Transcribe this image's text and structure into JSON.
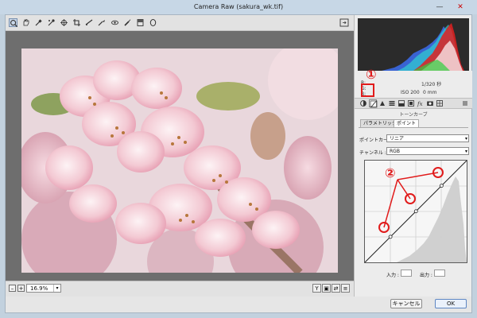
{
  "window": {
    "title": "Camera Raw (sakura_wk.tif)",
    "controls": {
      "minimize": "—",
      "close": "✕"
    }
  },
  "toolbar": {
    "tools": [
      "zoom-tool-icon",
      "hand-tool-icon",
      "white-balance-tool-icon",
      "color-sampler-tool-icon",
      "targeted-adjustment-tool-icon",
      "crop-tool-icon",
      "straighten-tool-icon",
      "spot-removal-tool-icon",
      "red-eye-removal-tool-icon",
      "adjustment-brush-icon",
      "graduated-filter-icon",
      "radial-filter-icon"
    ]
  },
  "preview": {
    "zoom_value": "16.9%",
    "zoom_minus": "–",
    "zoom_plus": "+",
    "dropdown_glyph": "▾",
    "view_buttons": [
      "Y",
      "▣",
      "⇄",
      "≡"
    ]
  },
  "camera_info": {
    "r_label": "R:",
    "g_label": "G:",
    "b_label": "B:",
    "shutter": "1/320 秒",
    "iso": "ISO 200",
    "focal_length": "0 mm"
  },
  "panel": {
    "section_title": "トーンカーブ",
    "tab_parametric": "パラメトリック",
    "tab_point": "ポイント",
    "point_curve_label": "ポイントカーブ :",
    "point_curve_value": "リニア",
    "channel_label": "チャンネル :",
    "channel_value": "RGB",
    "dropdown_glyph": "▾",
    "input_label": "入力 :",
    "output_label": "出力 :",
    "curve_points": [
      {
        "input": 0,
        "output": 0
      },
      {
        "input": 64,
        "output": 64
      },
      {
        "input": 128,
        "output": 128
      },
      {
        "input": 192,
        "output": 192
      },
      {
        "input": 255,
        "output": 255
      }
    ]
  },
  "annotations": {
    "marker_1": "①",
    "marker_2": "②",
    "color": "#e11b1b"
  },
  "buttons": {
    "cancel": "キャンセル",
    "ok": "OK"
  },
  "colors": {
    "accent": "#e11b1b",
    "preview_bg": "#6e6e6e",
    "histogram_bg": "#2b2b2b"
  }
}
